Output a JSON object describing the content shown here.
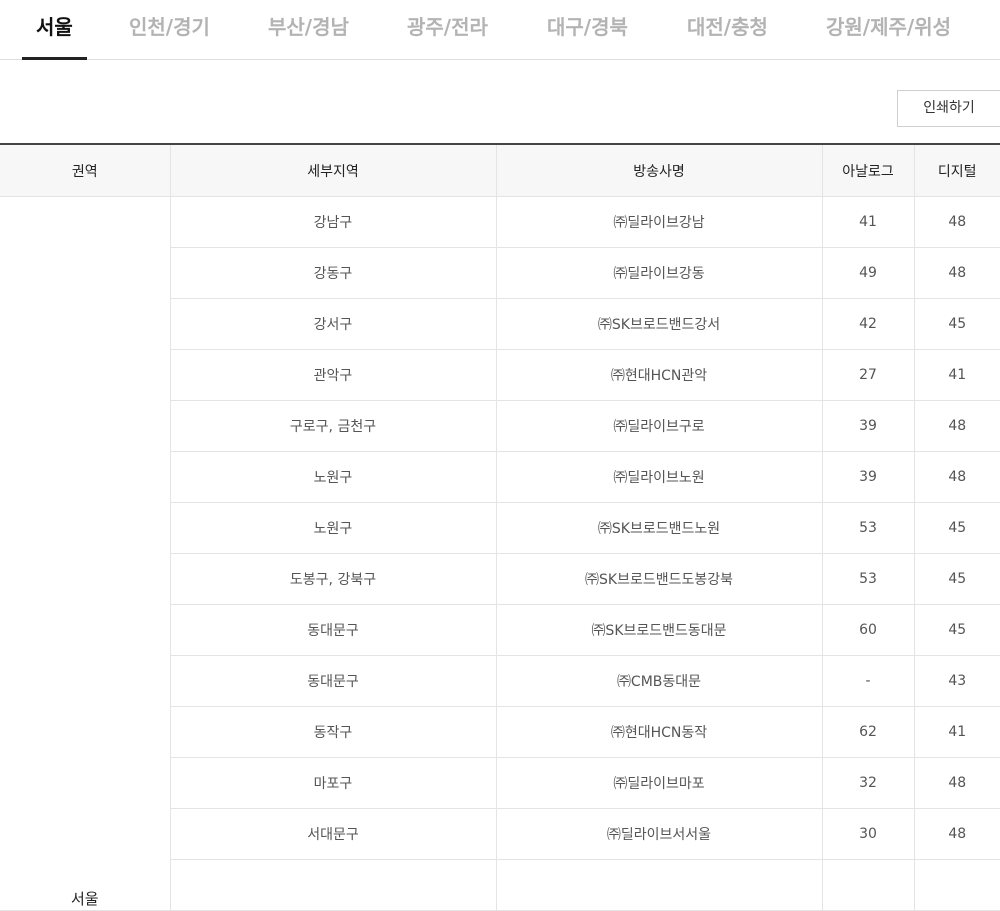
{
  "tabs": [
    {
      "label": "서울",
      "active": true
    },
    {
      "label": "인천/경기"
    },
    {
      "label": "부산/경남"
    },
    {
      "label": "광주/전라"
    },
    {
      "label": "대구/경북"
    },
    {
      "label": "대전/충청"
    },
    {
      "label": "강원/제주/위성"
    }
  ],
  "print_label": "인쇄하기",
  "table": {
    "headers": [
      "권역",
      "세부지역",
      "방송사명",
      "아날로그",
      "디지털"
    ],
    "region": "서울",
    "rows": [
      {
        "area": "강남구",
        "broadcaster": "㈜딜라이브강남",
        "analog": "41",
        "digital": "48"
      },
      {
        "area": "강동구",
        "broadcaster": "㈜딜라이브강동",
        "analog": "49",
        "digital": "48"
      },
      {
        "area": "강서구",
        "broadcaster": "㈜SK브로드밴드강서",
        "analog": "42",
        "digital": "45"
      },
      {
        "area": "관악구",
        "broadcaster": "㈜현대HCN관악",
        "analog": "27",
        "digital": "41"
      },
      {
        "area": "구로구, 금천구",
        "broadcaster": "㈜딜라이브구로",
        "analog": "39",
        "digital": "48"
      },
      {
        "area": "노원구",
        "broadcaster": "㈜딜라이브노원",
        "analog": "39",
        "digital": "48"
      },
      {
        "area": "노원구",
        "broadcaster": "㈜SK브로드밴드노원",
        "analog": "53",
        "digital": "45"
      },
      {
        "area": "도봉구, 강북구",
        "broadcaster": "㈜SK브로드밴드도봉강북",
        "analog": "53",
        "digital": "45"
      },
      {
        "area": "동대문구",
        "broadcaster": "㈜SK브로드밴드동대문",
        "analog": "60",
        "digital": "45"
      },
      {
        "area": "동대문구",
        "broadcaster": "㈜CMB동대문",
        "analog": "-",
        "digital": "43"
      },
      {
        "area": "동작구",
        "broadcaster": "㈜현대HCN동작",
        "analog": "62",
        "digital": "41"
      },
      {
        "area": "마포구",
        "broadcaster": "㈜딜라이브마포",
        "analog": "32",
        "digital": "48"
      },
      {
        "area": "서대문구",
        "broadcaster": "㈜딜라이브서서울",
        "analog": "30",
        "digital": "48"
      }
    ]
  }
}
